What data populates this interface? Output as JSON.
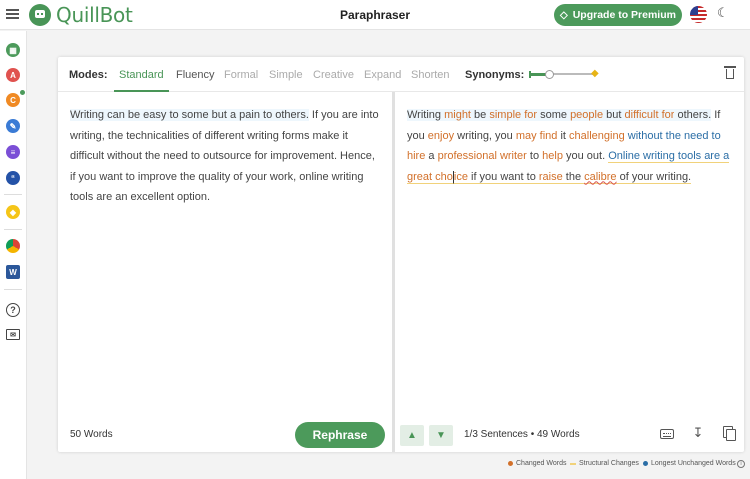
{
  "app": {
    "logo_text": "QuillBot",
    "page_title": "Paraphraser"
  },
  "header": {
    "upgrade_label": "Upgrade to Premium"
  },
  "colors": {
    "brand": "#499557",
    "changed": "#d2702a",
    "structural": "#f1d27a",
    "unchanged": "#2b6ea6"
  },
  "sidebar": {
    "items": [
      {
        "icon": "paraphraser-icon"
      },
      {
        "icon": "grammar-checker-icon"
      },
      {
        "icon": "plagiarism-checker-icon"
      },
      {
        "icon": "co-writer-icon"
      },
      {
        "icon": "summarizer-icon"
      },
      {
        "icon": "citation-generator-icon"
      },
      {
        "icon": "premium-gem-icon"
      },
      {
        "icon": "chrome-extension-icon"
      },
      {
        "icon": "word-addin-icon"
      },
      {
        "icon": "help-icon"
      },
      {
        "icon": "mail-icon"
      }
    ]
  },
  "toolbar": {
    "modes_label": "Modes:",
    "modes": [
      "Standard",
      "Fluency",
      "Formal",
      "Simple",
      "Creative",
      "Expand",
      "Shorten"
    ],
    "active_mode": "Standard",
    "synonyms_label": "Synonyms:",
    "synonyms_level": 0.3
  },
  "input": {
    "highlighted_sentence": "Writing can be easy to some but a pain to others.",
    "rest": " If you are into writing, the technicalities of different writing forms make it difficult without the need to outsource for improvement. Hence, if you want to improve the quality of your work, online writing tools are an excellent option.",
    "word_count": "50 Words",
    "rephrase_label": "Rephrase"
  },
  "output": {
    "tokens": [
      {
        "t": "Writing",
        "c": "plain",
        "hl": true
      },
      {
        "t": " ",
        "c": "plain",
        "hl": true
      },
      {
        "t": "might",
        "c": "changed",
        "hl": true
      },
      {
        "t": " be ",
        "c": "plain",
        "hl": true
      },
      {
        "t": "simple for",
        "c": "changed",
        "hl": true
      },
      {
        "t": " some ",
        "c": "plain",
        "hl": true
      },
      {
        "t": "people",
        "c": "changed",
        "hl": true
      },
      {
        "t": " but ",
        "c": "plain",
        "hl": true
      },
      {
        "t": "difficult for",
        "c": "changed",
        "hl": true
      },
      {
        "t": " others.",
        "c": "plain",
        "hl": true
      },
      {
        "t": " If you ",
        "c": "plain"
      },
      {
        "t": "enjoy",
        "c": "changed"
      },
      {
        "t": " writing, you ",
        "c": "plain"
      },
      {
        "t": "may find",
        "c": "changed"
      },
      {
        "t": " it ",
        "c": "plain"
      },
      {
        "t": "challenging",
        "c": "changed"
      },
      {
        "t": " without the need to",
        "c": "unchanged"
      },
      {
        "t": " ",
        "c": "plain"
      },
      {
        "t": "hire",
        "c": "changed"
      },
      {
        "t": " a ",
        "c": "plain"
      },
      {
        "t": "professional writer",
        "c": "changed"
      },
      {
        "t": " to ",
        "c": "plain"
      },
      {
        "t": "help",
        "c": "changed"
      },
      {
        "t": " you out. ",
        "c": "plain"
      },
      {
        "t": "Online writing tools are a",
        "c": "unchanged",
        "st": true
      },
      {
        "t": " ",
        "c": "plain",
        "st": true
      },
      {
        "t": "great cho",
        "c": "changed",
        "st": true
      },
      {
        "t": "ice",
        "c": "changed",
        "st": true,
        "cursor": true
      },
      {
        "t": " if you want to ",
        "c": "plain",
        "st": true
      },
      {
        "t": "raise",
        "c": "changed",
        "st": true
      },
      {
        "t": " the ",
        "c": "plain",
        "st": true
      },
      {
        "t": "calibre",
        "c": "changed",
        "st": true,
        "spell": true
      },
      {
        "t": " of your writing.",
        "c": "plain",
        "st": true
      }
    ],
    "sentence_info": "1/3 Sentences • 49 Words"
  },
  "legend": {
    "changed": "Changed Words",
    "structural": "Structural Changes",
    "unchanged": "Longest Unchanged Words"
  }
}
